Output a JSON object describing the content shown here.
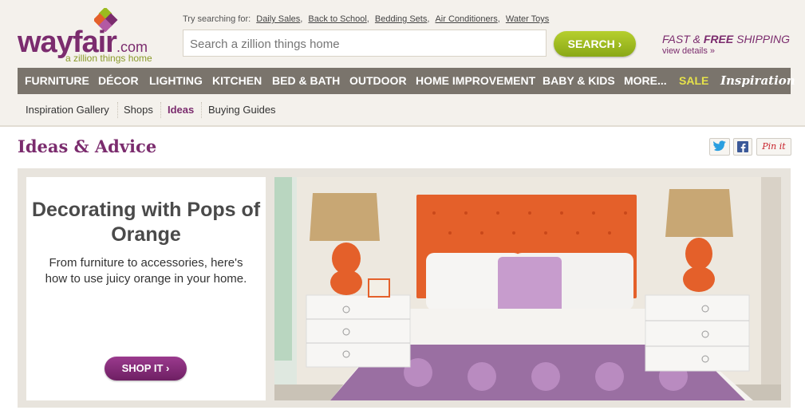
{
  "logo": {
    "word": "wayfair",
    "com": ".com",
    "tagline": "a zillion things home"
  },
  "search": {
    "try_label": "Try searching for:",
    "suggestions": [
      "Daily Sales",
      "Back to School",
      "Bedding Sets",
      "Air Conditioners",
      "Water Toys"
    ],
    "placeholder": "Search a zillion things home",
    "button_label": "SEARCH"
  },
  "shipping": {
    "fast": "FAST",
    "amp": "&",
    "free": "FREE",
    "shipping": "SHIPPING",
    "view_details": "view details »"
  },
  "nav": {
    "items": [
      "FURNITURE",
      "DÉCOR",
      "LIGHTING",
      "KITCHEN",
      "BED & BATH",
      "OUTDOOR",
      "HOME IMPROVEMENT",
      "BABY & KIDS",
      "MORE...",
      "SALE",
      "Inspiration"
    ]
  },
  "subnav": {
    "items": [
      "Inspiration Gallery",
      "Shops",
      "Ideas",
      "Buying Guides"
    ],
    "active": "Ideas"
  },
  "page": {
    "title": "Ideas & Advice"
  },
  "social": {
    "pinterest": "Pin it"
  },
  "feature": {
    "title": "Decorating with Pops of Orange",
    "description": "From furniture to accessories, here's how to use juicy orange in your home.",
    "button_label": "SHOP IT"
  },
  "colors": {
    "brand": "#7b2c6e",
    "accent_green": "#9bbb1f",
    "nav_bg": "#7a746c",
    "sale": "#e6e24a",
    "orange": "#e4602a"
  }
}
